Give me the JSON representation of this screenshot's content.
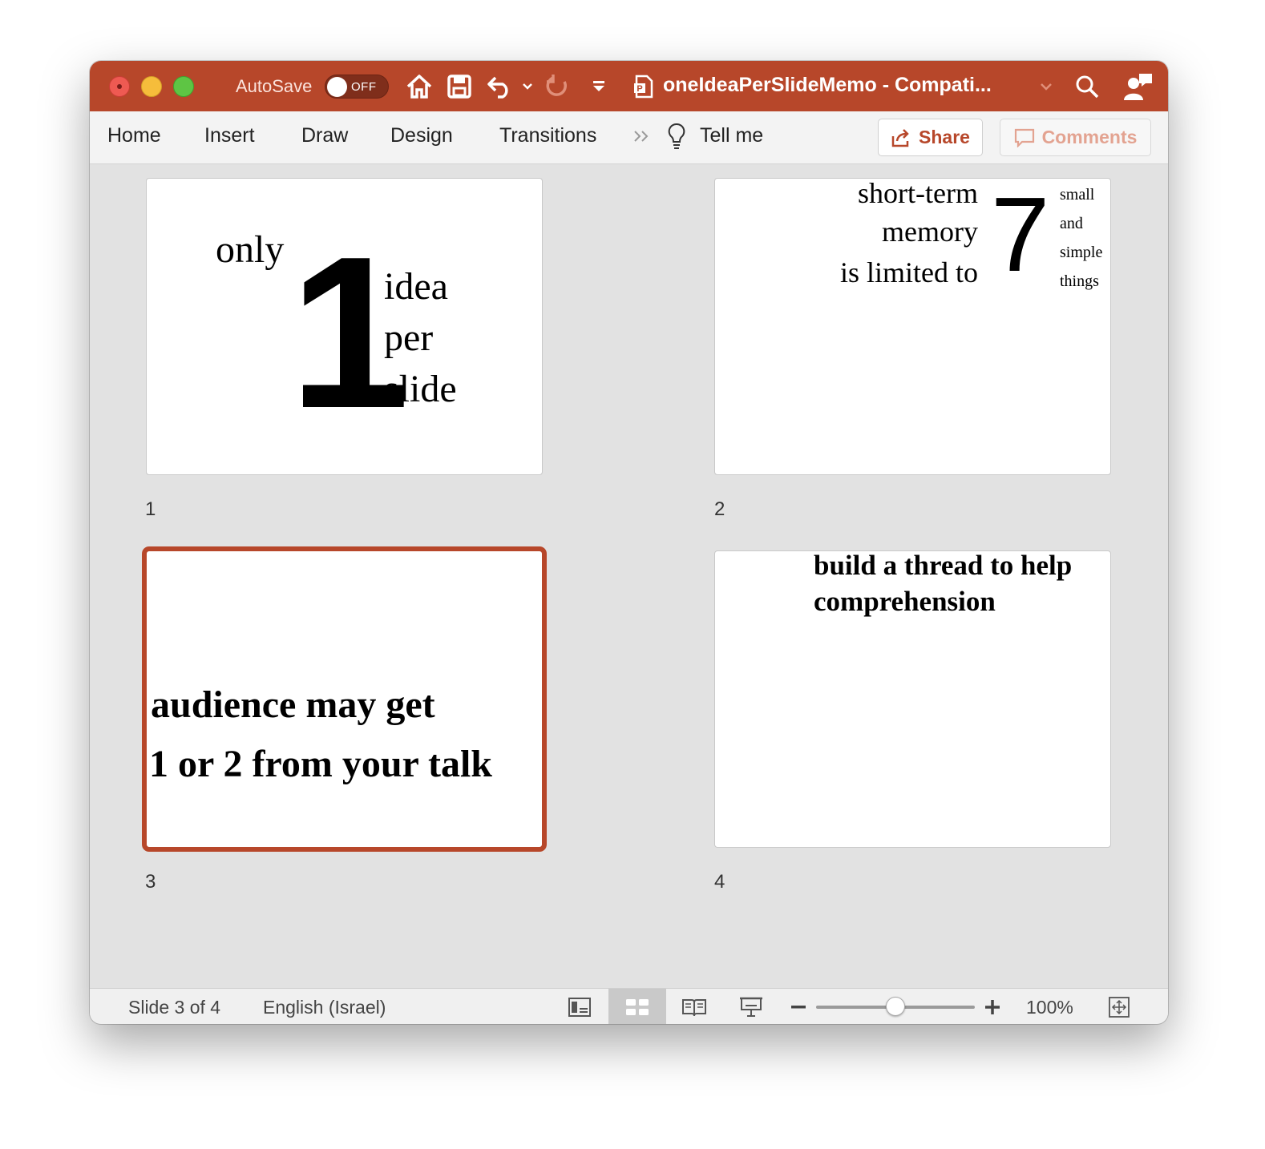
{
  "titlebar": {
    "autosave_label": "AutoSave",
    "autosave_state": "OFF",
    "document_title": "oneIdeaPerSlideMemo  -  Compati..."
  },
  "ribbon": {
    "tabs": [
      "Home",
      "Insert",
      "Draw",
      "Design",
      "Transitions"
    ],
    "tell_me": "Tell me",
    "share_label": "Share",
    "comments_label": "Comments"
  },
  "slides": [
    {
      "number": "1",
      "text": {
        "only": "only",
        "big": "1",
        "idea": "idea",
        "per": "per",
        "slide": "slide"
      }
    },
    {
      "number": "2",
      "text": {
        "line1": "short-term",
        "line2": "memory",
        "line3": "is limited to",
        "big": "7",
        "small1": "small",
        "small2": "and",
        "small3": "simple",
        "small4": "things"
      }
    },
    {
      "number": "3",
      "selected": true,
      "text": {
        "line1": "audience may get",
        "line2": "1 or 2 from your talk"
      }
    },
    {
      "number": "4",
      "text": {
        "line1": "build a thread to help",
        "line2": "comprehension"
      }
    }
  ],
  "statusbar": {
    "slide_info": "Slide 3 of 4",
    "language": "English (Israel)",
    "zoom": "100%",
    "zoom_fraction": 0.5
  },
  "colors": {
    "accent": "#b7472a",
    "background": "#e2e2e2"
  },
  "icons": {
    "titlebar": [
      "home-icon",
      "save-icon",
      "undo-icon",
      "redo-icon",
      "customize-toolbar-icon",
      "document-icon",
      "search-icon",
      "share-person-icon"
    ],
    "statusbar": [
      "normal-view-icon",
      "slide-sorter-icon",
      "reading-view-icon",
      "slideshow-icon",
      "fit-to-window-icon"
    ]
  }
}
